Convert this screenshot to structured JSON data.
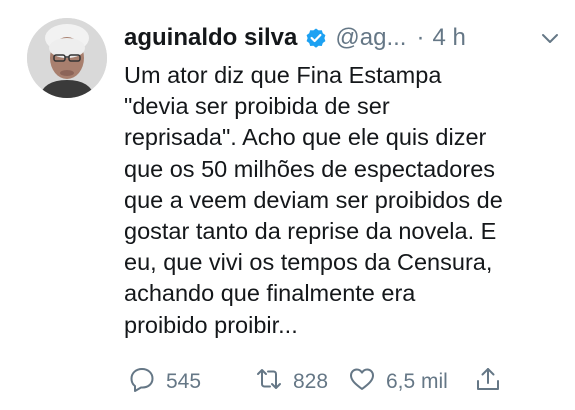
{
  "tweet": {
    "author_name": "aguinaldo silva",
    "handle": "@ag...",
    "separator": "·",
    "time": "4 h",
    "text_lines": [
      "Um ator diz que Fina Estampa",
      "\"devia ser proibida de ser",
      "reprisada\". Acho que ele quis dizer",
      "que os 50 milhões de espectadores",
      "que a veem deviam ser proibidos de",
      "gostar tanto da reprise da novela. E",
      "eu, que vivi os tempos da Censura,",
      "achando que finalmente era",
      "proibido proibir..."
    ],
    "replies": "545",
    "retweets": "828",
    "likes": "6,5 mil"
  },
  "icons": {
    "verified": "verified-badge-icon",
    "menu": "chevron-down-icon",
    "reply": "reply-icon",
    "retweet": "retweet-icon",
    "like": "heart-icon",
    "share": "share-icon"
  },
  "colors": {
    "text": "#14171a",
    "secondary": "#657786",
    "verified": "#1da1f2",
    "background": "#ffffff"
  }
}
